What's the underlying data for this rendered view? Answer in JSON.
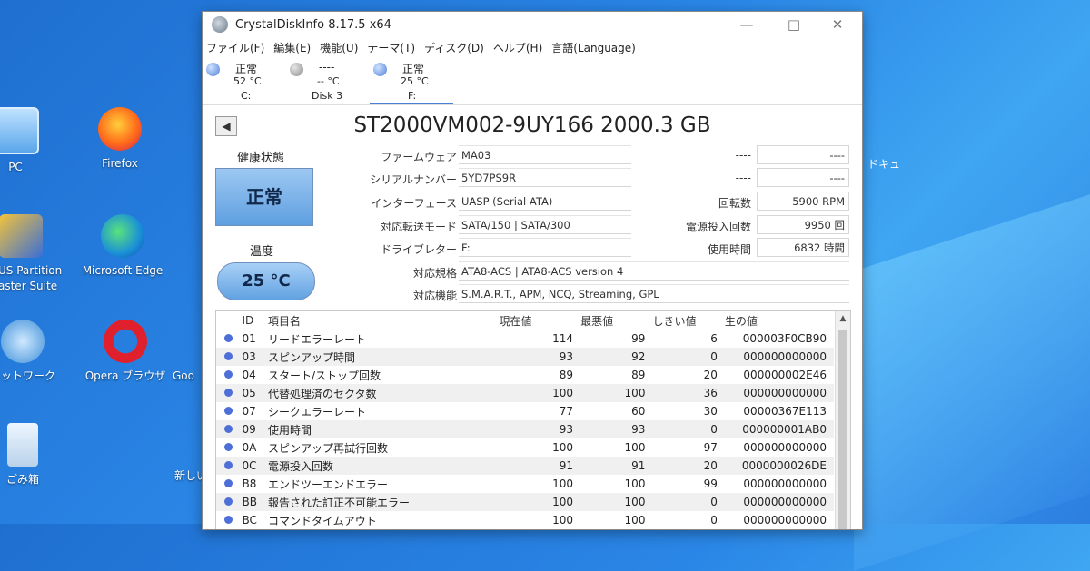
{
  "desktop": {
    "icons": [
      {
        "id": "pc",
        "label": "PC"
      },
      {
        "id": "firefox",
        "label": "Firefox"
      },
      {
        "id": "partition",
        "label": "US Partition\naster Suite"
      },
      {
        "id": "edge",
        "label": "Microsoft Edge"
      },
      {
        "id": "network",
        "label": "ネットワーク"
      },
      {
        "id": "opera",
        "label": "Opera ブラウザ"
      },
      {
        "id": "goo",
        "label": "Goo"
      },
      {
        "id": "recycle",
        "label": "ごみ箱"
      },
      {
        "id": "new",
        "label": "新しい"
      }
    ],
    "side_text": "ドキュ"
  },
  "window": {
    "title": "CrystalDiskInfo 8.17.5 x64",
    "menu": [
      "ファイル(F)",
      "編集(E)",
      "機能(U)",
      "テーマ(T)",
      "ディスク(D)",
      "ヘルプ(H)",
      "言語(Language)"
    ],
    "disks": [
      {
        "status": "正常",
        "temp": "52 °C",
        "name": "C:",
        "color": "#4f7fd8"
      },
      {
        "status": "----",
        "temp": "-- °C",
        "name": "Disk 3",
        "color": "#8a8a8a"
      },
      {
        "status": "正常",
        "temp": "25 °C",
        "name": "F:",
        "color": "#4f7fd8"
      }
    ],
    "model": "ST2000VM002-9UY166 2000.3 GB",
    "back_icon": "back-arrow-icon",
    "health_label": "健康状態",
    "health_value": "正常",
    "temp_label": "温度",
    "temp_value": "25 °C",
    "info": {
      "firmware_label": "ファームウェア",
      "firmware": "MA03",
      "serial_label": "シリアルナンバー",
      "serial": "5YD7PS9R",
      "interface_label": "インターフェース",
      "interface": "UASP (Serial ATA)",
      "transfer_label": "対応転送モード",
      "transfer": "SATA/150 | SATA/300",
      "drive_label": "ドライブレター",
      "drive": "F:",
      "standard_label": "対応規格",
      "standard": "ATA8-ACS | ATA8-ACS version 4",
      "features_label": "対応機能",
      "features": "S.M.A.R.T., APM, NCQ, Streaming, GPL",
      "blank1_label": "----",
      "blank1": "----",
      "blank2_label": "----",
      "blank2": "----",
      "rotation_label": "回転数",
      "rotation": "5900 RPM",
      "poweron_count_label": "電源投入回数",
      "poweron_count": "9950 回",
      "poweron_hours_label": "使用時間",
      "poweron_hours": "6832 時間"
    },
    "smart_headers": [
      "ID",
      "項目名",
      "現在値",
      "最悪値",
      "しきい値",
      "生の値"
    ],
    "smart_rows": [
      [
        "01",
        "リードエラーレート",
        "114",
        "99",
        "6",
        "000003F0CB90"
      ],
      [
        "03",
        "スピンアップ時間",
        "93",
        "92",
        "0",
        "000000000000"
      ],
      [
        "04",
        "スタート/ストップ回数",
        "89",
        "89",
        "20",
        "000000002E46"
      ],
      [
        "05",
        "代替処理済のセクタ数",
        "100",
        "100",
        "36",
        "000000000000"
      ],
      [
        "07",
        "シークエラーレート",
        "77",
        "60",
        "30",
        "00000367E113"
      ],
      [
        "09",
        "使用時間",
        "93",
        "93",
        "0",
        "000000001AB0"
      ],
      [
        "0A",
        "スピンアップ再試行回数",
        "100",
        "100",
        "97",
        "000000000000"
      ],
      [
        "0C",
        "電源投入回数",
        "91",
        "91",
        "20",
        "0000000026DE"
      ],
      [
        "B8",
        "エンドツーエンドエラー",
        "100",
        "100",
        "99",
        "000000000000"
      ],
      [
        "BB",
        "報告された訂正不可能エラー",
        "100",
        "100",
        "0",
        "000000000000"
      ],
      [
        "BC",
        "コマンドタイムアウト",
        "100",
        "100",
        "0",
        "000000000000"
      ]
    ]
  }
}
